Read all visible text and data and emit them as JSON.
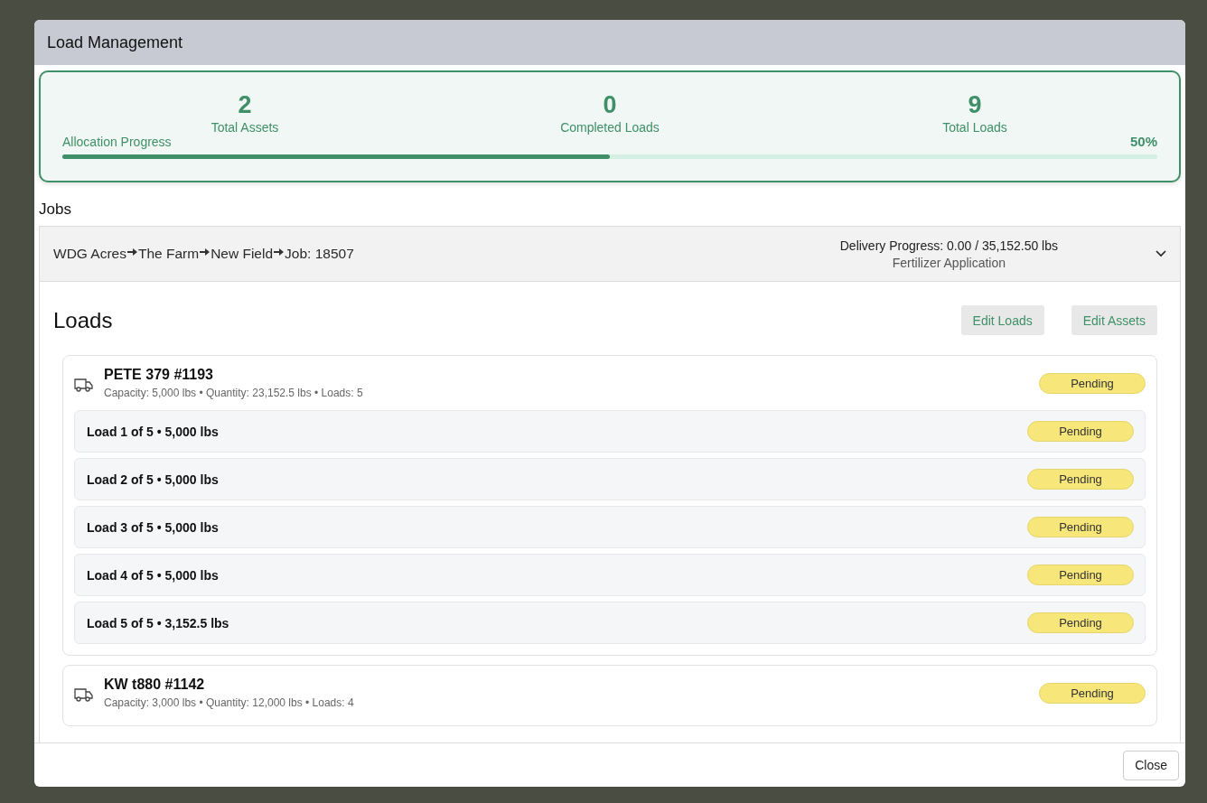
{
  "dialog": {
    "title": "Load Management"
  },
  "summary": {
    "stats": [
      {
        "value": "2",
        "label": "Total Assets"
      },
      {
        "value": "0",
        "label": "Completed Loads"
      },
      {
        "value": "9",
        "label": "Total Loads"
      }
    ],
    "progress": {
      "label": "Allocation Progress",
      "reading": "50%",
      "level": 0.5
    }
  },
  "jobs_heading": "Jobs",
  "job": {
    "path": [
      "WDG Acres",
      "The Farm",
      "New Field",
      "Job: 18507"
    ],
    "delivery_progress": "Delivery Progress: 0.00 / 35,152.50 lbs",
    "type": "Fertilizer Application",
    "expanded": true
  },
  "loads_heading": "Loads",
  "actions": [
    "Edit Loads",
    "Edit Assets"
  ],
  "assets": [
    {
      "name": "PETE 379 #1193",
      "details": "Capacity: 5,000 lbs • Quantity: 23,152.5 lbs • Loads: 5",
      "status": "Pending",
      "loads": [
        {
          "label": "Load 1 of 5 • 5,000 lbs",
          "status": "Pending"
        },
        {
          "label": "Load 2 of 5 • 5,000 lbs",
          "status": "Pending"
        },
        {
          "label": "Load 3 of 5 • 5,000 lbs",
          "status": "Pending"
        },
        {
          "label": "Load 4 of 5 • 5,000 lbs",
          "status": "Pending"
        },
        {
          "label": "Load 5 of 5 • 3,152.5 lbs",
          "status": "Pending"
        }
      ]
    },
    {
      "name": "KW t880 #1142",
      "details": "Capacity: 3,000 lbs • Quantity: 12,000 lbs • Loads: 4",
      "status": "Pending"
    }
  ],
  "footer_buttons": [
    "Close"
  ]
}
